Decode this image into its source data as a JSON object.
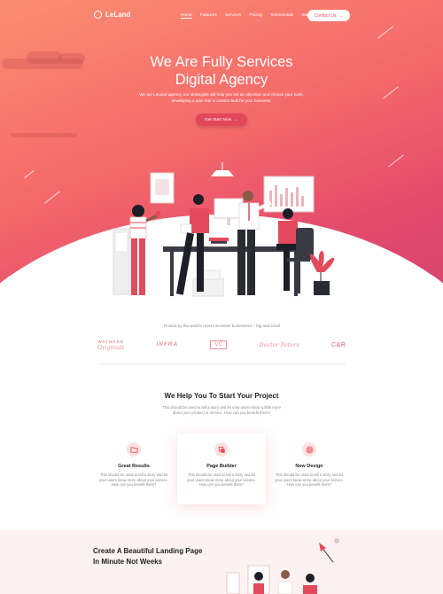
{
  "brand": {
    "name": "LeLand"
  },
  "nav": {
    "links": [
      "Home",
      "Features",
      "Services",
      "Pricing",
      "Testimonials",
      "Start Now"
    ],
    "contact_label": "Contact Us"
  },
  "hero": {
    "title_line1": "We Are Fully Services",
    "title_line2": "Digital Agency",
    "subtitle": "We are LeLand agency, our strategists will help you set an objective and choose your tools, developing a plan that is custom built for your business.",
    "cta_label": "Get Start Now"
  },
  "trusted": {
    "text": "Trusted by the world's most innovative businesses – big and small",
    "brands": [
      {
        "line1": "WAYWARD",
        "line2": "Originals"
      },
      {
        "line1": "INFRA",
        "line2": ""
      },
      {
        "line1": "VC",
        "line2": ""
      },
      {
        "line1": "Doctor Peters",
        "line2": ""
      },
      {
        "line1": "C&R",
        "line2": ""
      }
    ]
  },
  "help": {
    "title": "We Help You To Start Your Project",
    "subtitle": "This should be used to tell a story and let your users know a little more about your product or service. How can you benefit them?"
  },
  "features": [
    {
      "title": "Great Results",
      "desc": "This should be used to tell a story and let your users know more about your service. How can you benefit them?",
      "icon": "folder-icon"
    },
    {
      "title": "Page Builder",
      "desc": "This should be used to tell a story and let your users know more about your service. How can you benefit them?",
      "icon": "layers-icon"
    },
    {
      "title": "New Design",
      "desc": "This should be used to tell a story and let your users know more about your service. How can you benefit them?",
      "icon": "fingerprint-icon"
    }
  ],
  "bottom": {
    "title_line1": "Create A Beautiful Landing Page",
    "title_line2": "In Minute Not Weeks"
  },
  "colors": {
    "accent": "#e3475b",
    "gradient_start": "#fb8e72",
    "gradient_end": "#d24370",
    "brand_pink": "#e8909a"
  }
}
